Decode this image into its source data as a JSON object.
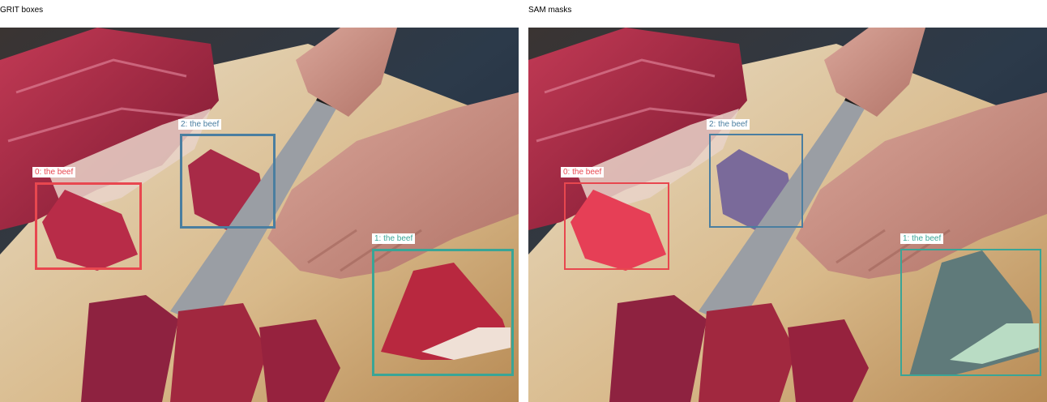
{
  "panels": {
    "left": {
      "title": "GRIT boxes"
    },
    "right": {
      "title": "SAM masks"
    }
  },
  "detections": [
    {
      "label": "0: the beef",
      "color": "#e8474f"
    },
    {
      "label": "1: the beef",
      "color": "#3aa596"
    },
    {
      "label": "2: the beef",
      "color": "#4a7ea0"
    }
  ]
}
